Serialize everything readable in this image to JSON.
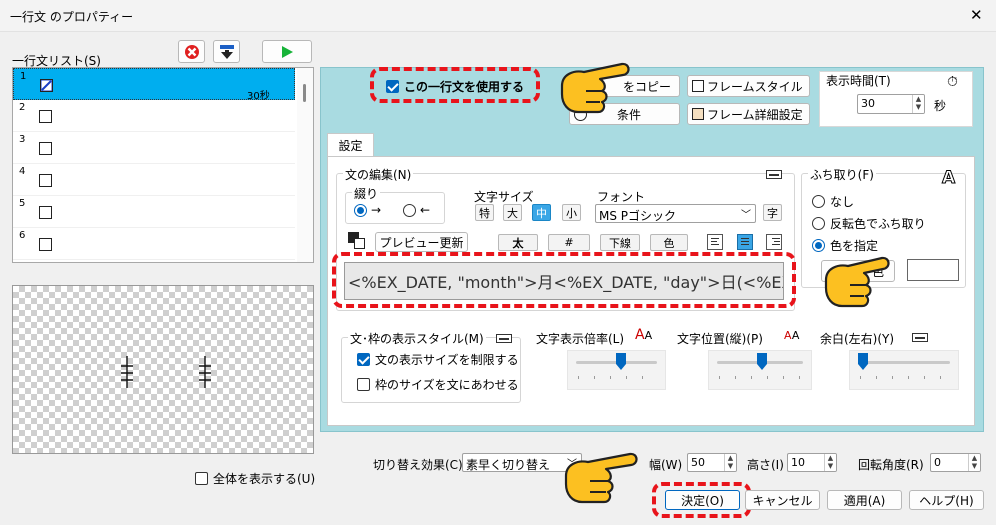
{
  "window": {
    "title": "一行文 のプロパティー",
    "close_glyph": "✕"
  },
  "list": {
    "label": "一行文リスト(S)",
    "rows": [
      {
        "num": "1",
        "duration": "30秒"
      },
      {
        "num": "2"
      },
      {
        "num": "3"
      },
      {
        "num": "4"
      },
      {
        "num": "5"
      },
      {
        "num": "6"
      }
    ]
  },
  "show_all": {
    "label": "全体を表示する(U)"
  },
  "use_line": {
    "label": "この一行文を使用する"
  },
  "top_buttons": {
    "copy": "をコピー",
    "condition": "条件",
    "frame_style": "フレームスタイル",
    "frame_detail": "フレーム詳細設定"
  },
  "display_time": {
    "label": "表示時間(T)",
    "value": "30",
    "unit": "秒"
  },
  "tab": {
    "label": "設定"
  },
  "edit_group": {
    "title": "文の編集(N)",
    "direction_label": "綴り",
    "direction_ltr": "→",
    "direction_rtl": "←",
    "size_label": "文字サイズ",
    "sizes": [
      "特",
      "大",
      "中",
      "小"
    ],
    "font_label": "フォント",
    "font_value": "MS Pゴシック",
    "font_btn": "字",
    "preview_btn": "プレビュー更新",
    "bold": "太",
    "hash": "#",
    "underline": "下線",
    "color": "色",
    "text_value": "<%EX_DATE, \"month\">月<%EX_DATE, \"day\">日(<%EX_"
  },
  "border_group": {
    "title": "ふち取り(F)",
    "none": "なし",
    "invert": "反転色でふち取り",
    "specify": "色を指定",
    "color_btn": "色"
  },
  "frame_group": {
    "title": "文･枠の表示スタイル(M)",
    "limit": "文の表示サイズを制限する",
    "fit": "枠のサイズを文にあわせる"
  },
  "sliders": {
    "scale": "文字表示倍率(L)",
    "vpos": "文字位置(縦)(P)",
    "margin": "余白(左右)(Y)"
  },
  "bottom": {
    "effect_label": "切り替え効果(C)",
    "effect_value": "素早く切り替え",
    "width_label": "幅(W)",
    "width_value": "50",
    "height_label": "高さ(I)",
    "height_value": "10",
    "angle_label": "回転角度(R)",
    "angle_value": "0"
  },
  "buttons": {
    "ok": "決定(O)",
    "cancel": "キャンセル",
    "apply": "適用(A)",
    "help": "ヘルプ(H)"
  }
}
